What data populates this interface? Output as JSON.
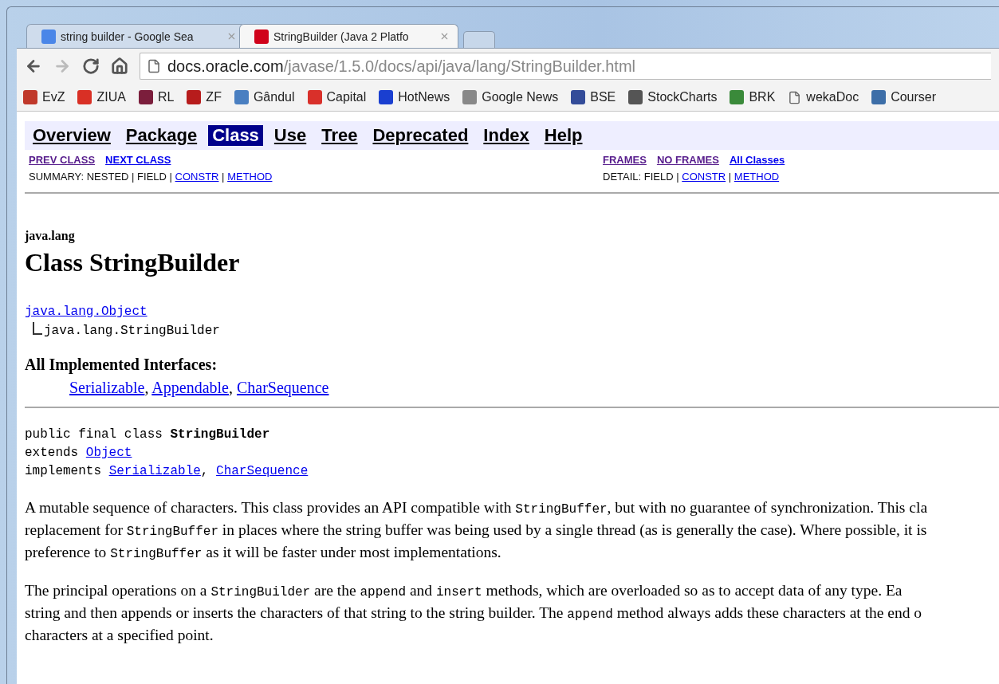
{
  "tabs": [
    {
      "title": "string builder - Google Sea",
      "selected": false
    },
    {
      "title": "StringBuilder (Java 2 Platfo",
      "selected": true
    }
  ],
  "address_bar": {
    "host": "docs.oracle.com",
    "path": "/javase/1.5.0/docs/api/java/lang/StringBuilder.html"
  },
  "bookmarks": [
    {
      "label": "EvZ",
      "kind": "site"
    },
    {
      "label": "ZIUA",
      "kind": "site"
    },
    {
      "label": "RL",
      "kind": "site"
    },
    {
      "label": "ZF",
      "kind": "site"
    },
    {
      "label": "Gândul",
      "kind": "site"
    },
    {
      "label": "Capital",
      "kind": "site"
    },
    {
      "label": "HotNews",
      "kind": "site"
    },
    {
      "label": "Google News",
      "kind": "site"
    },
    {
      "label": "BSE",
      "kind": "site"
    },
    {
      "label": "StockCharts",
      "kind": "site"
    },
    {
      "label": "BRK",
      "kind": "site"
    },
    {
      "label": "wekaDoc",
      "kind": "page"
    },
    {
      "label": "Courser",
      "kind": "site"
    }
  ],
  "nav_bar": [
    {
      "label": "Overview",
      "selected": false
    },
    {
      "label": "Package",
      "selected": false
    },
    {
      "label": "Class",
      "selected": true
    },
    {
      "label": "Use",
      "selected": false
    },
    {
      "label": "Tree",
      "selected": false
    },
    {
      "label": "Deprecated",
      "selected": false
    },
    {
      "label": "Index",
      "selected": false
    },
    {
      "label": "Help",
      "selected": false
    }
  ],
  "sub_nav_left": {
    "links": [
      {
        "label": "PREV CLASS",
        "visited": true
      },
      {
        "label": "NEXT CLASS",
        "visited": false
      }
    ],
    "summary": {
      "label": "SUMMARY:",
      "separator": "|",
      "items": [
        {
          "text": "NESTED",
          "link": false
        },
        {
          "text": "FIELD",
          "link": false
        },
        {
          "text": "CONSTR",
          "link": true
        },
        {
          "text": "METHOD",
          "link": true
        }
      ]
    }
  },
  "sub_nav_right": {
    "links": [
      {
        "label": "FRAMES",
        "visited": true
      },
      {
        "label": "NO FRAMES",
        "visited": true
      },
      {
        "label": "All Classes",
        "visited": false
      }
    ],
    "detail": {
      "label": "DETAIL:",
      "separator": "|",
      "items": [
        {
          "text": "FIELD",
          "link": false
        },
        {
          "text": "CONSTR",
          "link": true
        },
        {
          "text": "METHOD",
          "link": true
        }
      ]
    }
  },
  "package": "java.lang",
  "title": "Class StringBuilder",
  "hierarchy": {
    "parent": "java.lang.Object",
    "child": "java.lang.StringBuilder"
  },
  "interfaces": {
    "heading": "All Implemented Interfaces:",
    "separator": ",",
    "items": [
      "Serializable",
      "Appendable",
      "CharSequence"
    ]
  },
  "declaration": [
    [
      {
        "text": "public final class ",
        "kind": "code"
      },
      {
        "text": "StringBuilder",
        "kind": "bold"
      }
    ],
    [
      {
        "text": "extends ",
        "kind": "code"
      },
      {
        "text": "Object",
        "kind": "link"
      }
    ],
    [
      {
        "text": "implements ",
        "kind": "code"
      },
      {
        "text": "Serializable",
        "kind": "link"
      },
      {
        "text": ", ",
        "kind": "code"
      },
      {
        "text": "CharSequence",
        "kind": "link"
      }
    ]
  ],
  "paragraphs": [
    [
      [
        {
          "text": "A mutable sequence of characters. This class provides an API compatible with ",
          "kind": "text"
        },
        {
          "text": "StringBuffer",
          "kind": "code"
        },
        {
          "text": ", but with no guarantee of synchronization. This cla",
          "kind": "text"
        }
      ],
      [
        {
          "text": "replacement for ",
          "kind": "text"
        },
        {
          "text": "StringBuffer",
          "kind": "code"
        },
        {
          "text": " in places where the string buffer was being used by a single thread (as is generally the case). Where possible, it is",
          "kind": "text"
        }
      ],
      [
        {
          "text": "preference to ",
          "kind": "text"
        },
        {
          "text": "StringBuffer",
          "kind": "code"
        },
        {
          "text": " as it will be faster under most implementations.",
          "kind": "text"
        }
      ]
    ],
    [
      [
        {
          "text": "The principal operations on a ",
          "kind": "text"
        },
        {
          "text": "StringBuilder",
          "kind": "code"
        },
        {
          "text": " are the ",
          "kind": "text"
        },
        {
          "text": "append",
          "kind": "code"
        },
        {
          "text": " and ",
          "kind": "text"
        },
        {
          "text": "insert",
          "kind": "code"
        },
        {
          "text": " methods, which are overloaded so as to accept data of any type. Ea",
          "kind": "text"
        }
      ],
      [
        {
          "text": "string and then appends or inserts the characters of that string to the string builder. The ",
          "kind": "text"
        },
        {
          "text": "append",
          "kind": "code"
        },
        {
          "text": " method always adds these characters at the end o",
          "kind": "text"
        }
      ],
      [
        {
          "text": "characters at a specified point.",
          "kind": "text"
        }
      ]
    ]
  ]
}
